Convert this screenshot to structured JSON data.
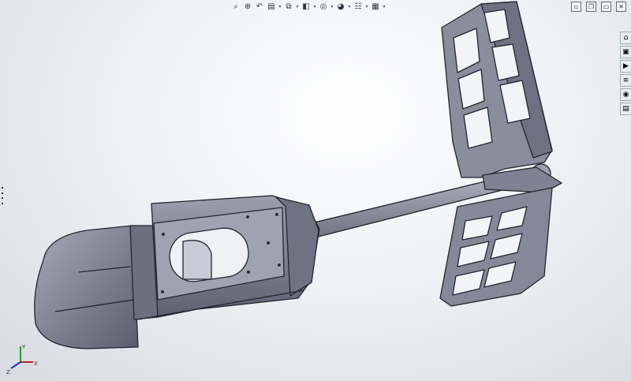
{
  "toolbar": {
    "items": [
      {
        "name": "zoom-to-fit-icon",
        "glyph": "⌕"
      },
      {
        "name": "zoom-to-area-icon",
        "glyph": "⊕"
      },
      {
        "name": "previous-view-icon",
        "glyph": "↶"
      },
      {
        "name": "section-view-icon",
        "glyph": "▤"
      },
      {
        "name": "view-orientation-icon",
        "glyph": "⧉"
      },
      {
        "name": "display-style-icon",
        "glyph": "◧"
      },
      {
        "name": "hide-show-items-icon",
        "glyph": "◎"
      },
      {
        "name": "edit-appearance-icon",
        "glyph": "◕"
      },
      {
        "name": "apply-scene-icon",
        "glyph": "☷"
      },
      {
        "name": "view-settings-icon",
        "glyph": "▦"
      }
    ]
  },
  "window_controls": [
    "▫",
    "❐",
    "▭",
    "✕"
  ],
  "task_pane": [
    "⌂",
    "▣",
    "▶",
    "≡",
    "◉",
    "▤"
  ],
  "triad": {
    "x": "X",
    "y": "Y",
    "z": "Z"
  },
  "colors": {
    "part": "#7a7d8e",
    "edge": "#23252f",
    "background": "#e8ebf0"
  }
}
